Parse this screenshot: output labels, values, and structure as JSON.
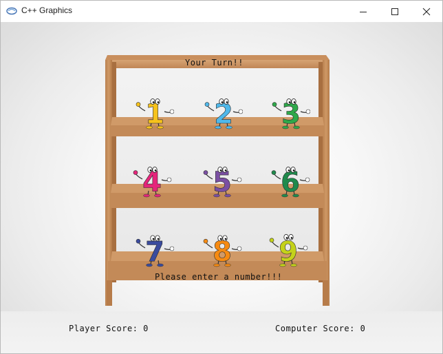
{
  "window": {
    "title": "C++ Graphics",
    "app_icon": "cpp-graphics-icon",
    "controls": [
      "minimize-icon",
      "maximize-icon",
      "close-icon"
    ]
  },
  "game": {
    "turn_message": "Your Turn!!",
    "prompt": "Please enter a number!!!",
    "player_score_label": "Player Score: 0",
    "computer_score_label": "Computer Score: 0",
    "numbers": [
      {
        "label": "1",
        "color": "#f6c21b"
      },
      {
        "label": "2",
        "color": "#4fb8ea"
      },
      {
        "label": "3",
        "color": "#2ea84a"
      },
      {
        "label": "4",
        "color": "#e5257b"
      },
      {
        "label": "5",
        "color": "#7a4fa3"
      },
      {
        "label": "6",
        "color": "#1f8a4c"
      },
      {
        "label": "7",
        "color": "#3a4b9e"
      },
      {
        "label": "8",
        "color": "#f58a12"
      },
      {
        "label": "9",
        "color": "#c4d21a"
      }
    ]
  }
}
